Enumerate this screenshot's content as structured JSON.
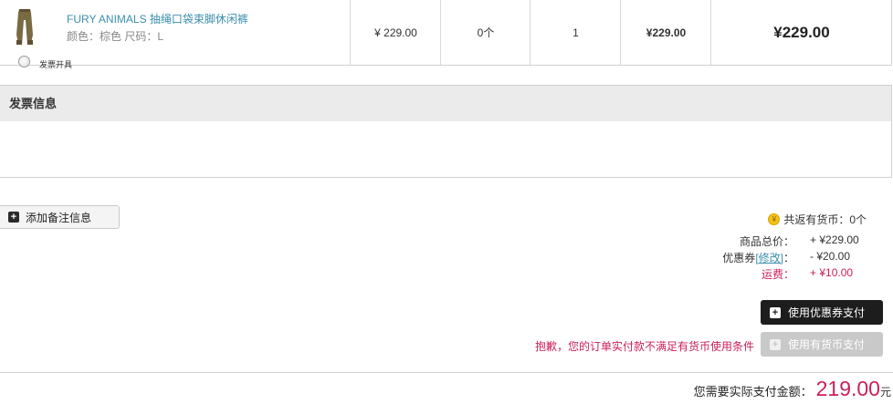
{
  "product": {
    "name": "FURY ANIMALS 抽绳口袋束脚休闲裤",
    "attributes": "颜色：棕色 尺码：L",
    "unit_price": "¥ 229.00",
    "coins": "0个",
    "quantity": "1",
    "subtotal": "¥229.00",
    "total": "¥229.00"
  },
  "invoice": {
    "title": "发票信息",
    "option_label": "发票开具"
  },
  "note_button": {
    "label": "添加备注信息"
  },
  "summary": {
    "coins_back": "共返有货币：0个",
    "goods_total_label": "商品总价：",
    "goods_total_value": "+ ¥229.00",
    "coupon_label": "优惠券",
    "coupon_edit": "[修改]",
    "coupon_colon": "：",
    "coupon_value": "- ¥20.00",
    "shipping_label": "运费：",
    "shipping_value": "+ ¥10.00"
  },
  "actions": {
    "coupon_pay": "使用优惠券支付",
    "coins_pay": "使用有货币支付",
    "coins_warning": "抱歉，您的订单实付款不满足有货币使用条件"
  },
  "payment": {
    "label": "您需要实际支付金额：",
    "amount": "219.00",
    "unit": "元"
  },
  "colors": {
    "accent_pink": "#cc1f5a",
    "link_blue": "#3c8fae",
    "dark_button": "#1d1d1d"
  }
}
